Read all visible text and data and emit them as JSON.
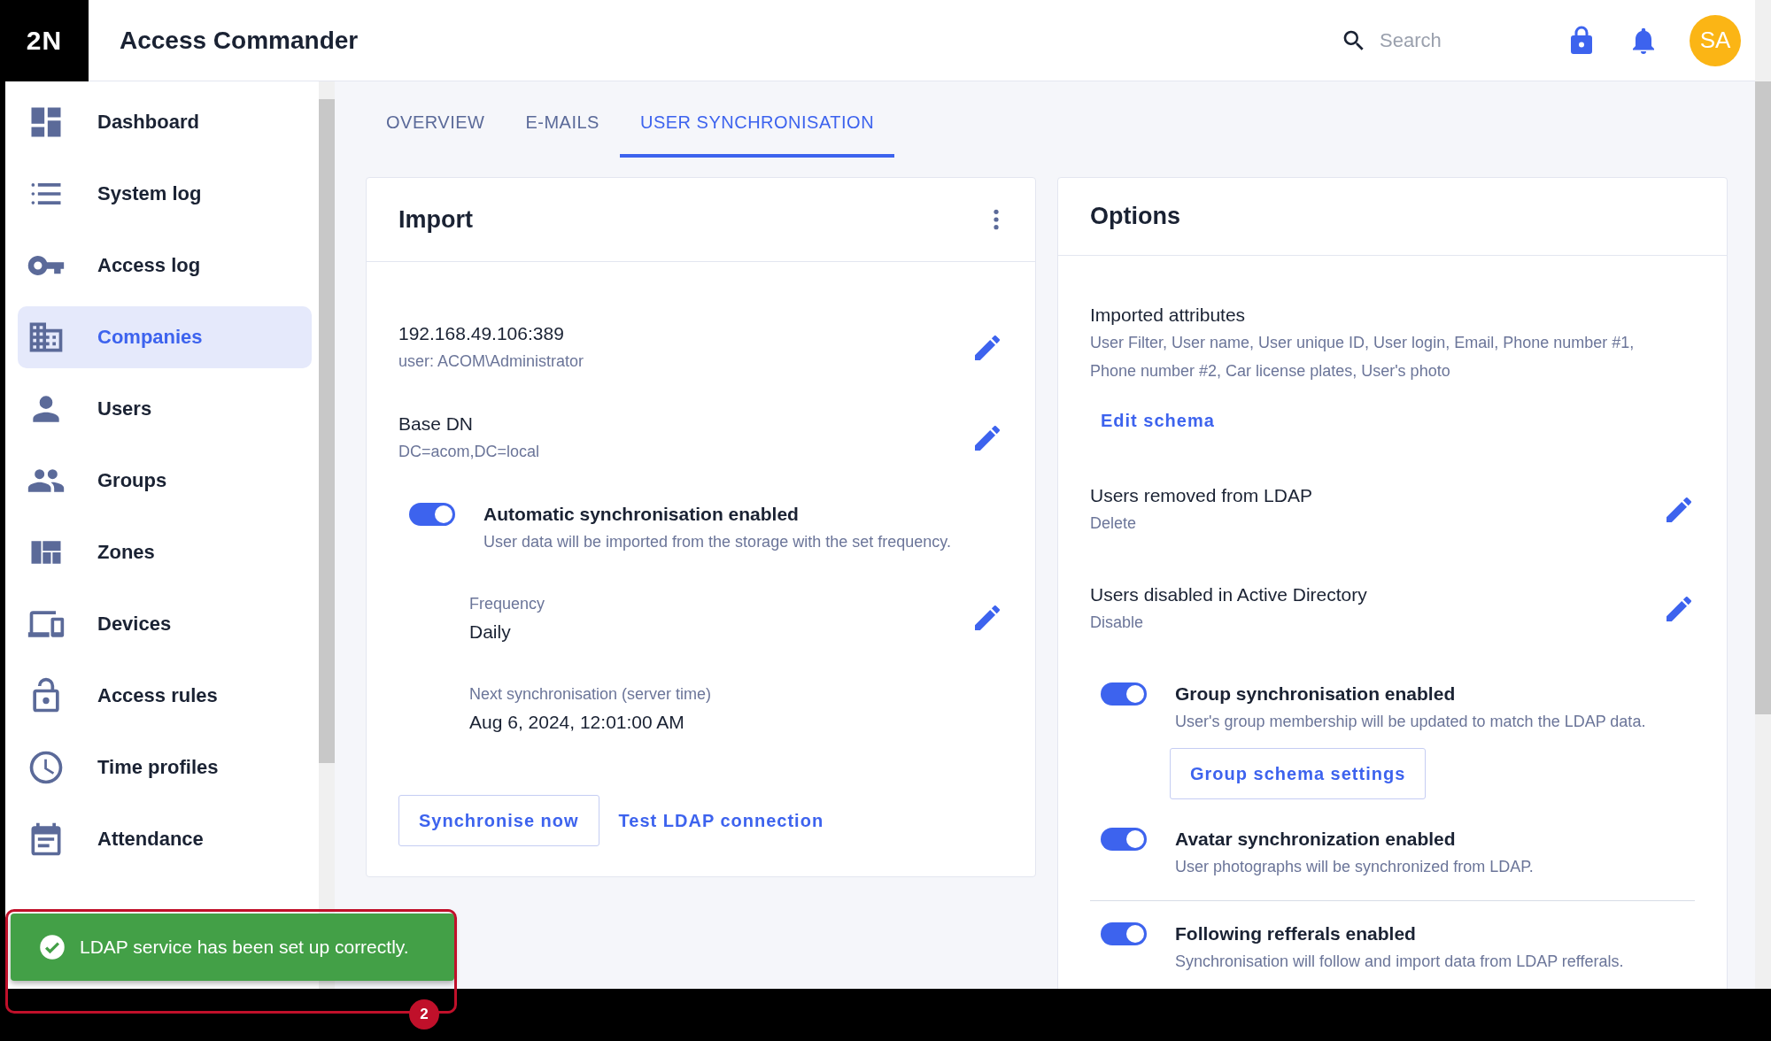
{
  "app": {
    "logo": "2N",
    "title": "Access Commander"
  },
  "header": {
    "search": {
      "placeholder": "Search"
    },
    "avatar": "SA"
  },
  "sidebar": {
    "items": [
      {
        "label": "Dashboard",
        "kind": "dashboard",
        "selected": false
      },
      {
        "label": "System log",
        "kind": "list",
        "selected": false
      },
      {
        "label": "Access log",
        "kind": "key",
        "selected": false
      },
      {
        "label": "Companies",
        "kind": "building",
        "selected": true
      },
      {
        "label": "Users",
        "kind": "person",
        "selected": false
      },
      {
        "label": "Groups",
        "kind": "people",
        "selected": false
      },
      {
        "label": "Zones",
        "kind": "zones",
        "selected": false
      },
      {
        "label": "Devices",
        "kind": "devices",
        "selected": false
      },
      {
        "label": "Access rules",
        "kind": "lock",
        "selected": false
      },
      {
        "label": "Time profiles",
        "kind": "clock",
        "selected": false
      },
      {
        "label": "Attendance",
        "kind": "calendar",
        "selected": false
      }
    ]
  },
  "tabs": [
    {
      "label": "OVERVIEW",
      "selected": false
    },
    {
      "label": "E-MAILS",
      "selected": false
    },
    {
      "label": "USER SYNCHRONISATION",
      "selected": true
    }
  ],
  "import": {
    "title": "Import",
    "entries": [
      {
        "title": "192.168.49.106:389",
        "subtitle": "user: ACOM\\Administrator"
      },
      {
        "title": "Base DN",
        "subtitle": "DC=acom,DC=local"
      }
    ],
    "toggle": {
      "title": "Automatic synchronisation enabled",
      "description": "User data will be imported from the storage with the set frequency.",
      "on": true
    },
    "details": [
      {
        "label": "Frequency",
        "value": "Daily",
        "editable": true
      },
      {
        "label": "Next synchronisation (server time)",
        "value": "Aug 6, 2024, 12:01:00 AM",
        "editable": false
      }
    ],
    "buttons": [
      {
        "label": "Synchronise now",
        "kind": "outlined"
      },
      {
        "label": "Test LDAP connection",
        "kind": "text"
      }
    ]
  },
  "options": {
    "title": "Options",
    "attributes": {
      "label": "Imported attributes",
      "value": "User Filter, User name, User unique ID, User login, Email, Phone number #1, Phone number #2, Car license plates, User's photo",
      "link": "Edit schema"
    },
    "entries": [
      {
        "title": "Users removed from LDAP",
        "subtitle": "Delete"
      },
      {
        "title": "Users disabled in Active Directory",
        "subtitle": "Disable"
      }
    ],
    "toggles": [
      {
        "title": "Group synchronisation enabled",
        "description": "User's group membership will be updated to match the LDAP data.",
        "on": true,
        "button": "Group schema settings",
        "separated": false
      },
      {
        "title": "Avatar synchronization enabled",
        "description": "User photographs will be synchronized from LDAP.",
        "on": true,
        "separated": false
      },
      {
        "title": "Following refferals enabled",
        "description": "Synchronisation will follow and import data from LDAP refferals.",
        "on": true,
        "separated": true
      }
    ]
  },
  "toast": {
    "kind": "success",
    "message": "LDAP service has been set up correctly."
  },
  "annotation": {
    "number": "2"
  }
}
